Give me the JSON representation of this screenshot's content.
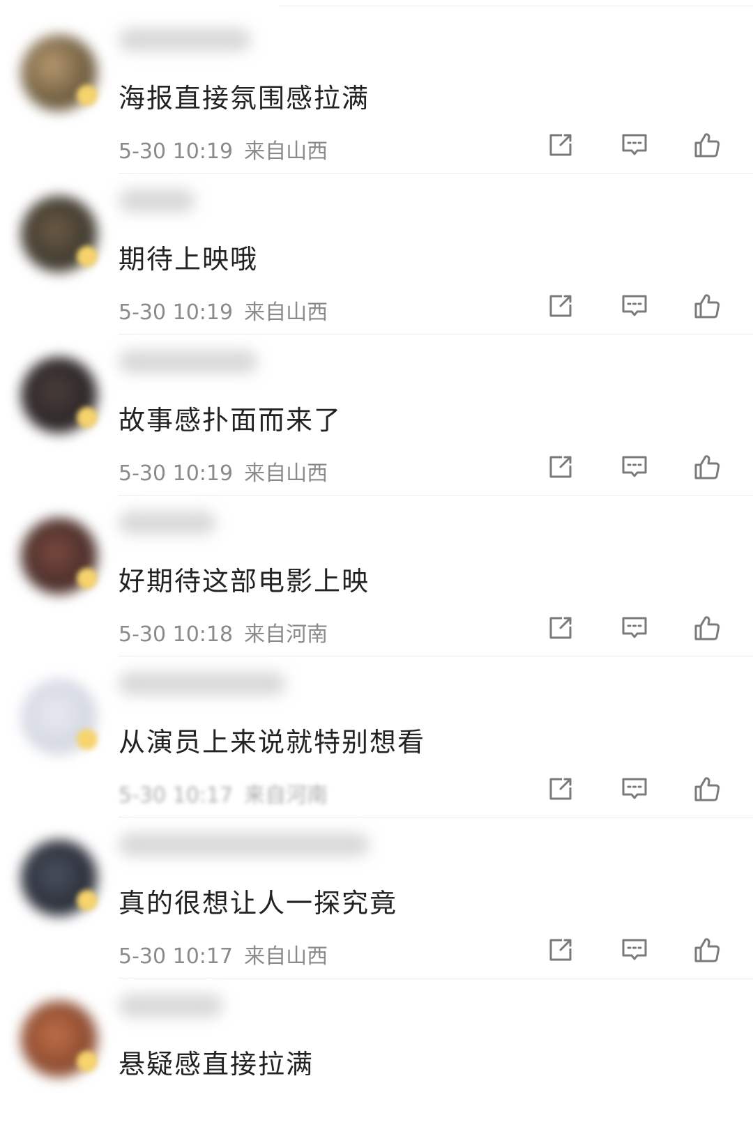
{
  "colors": {
    "text_primary": "#222222",
    "text_secondary": "#8a8a8a",
    "icon": "#7a7a7a",
    "divider": "#ececec",
    "background": "#ffffff"
  },
  "icons": {
    "share": "share-icon",
    "reply": "comment-icon",
    "like": "thumbs-up-icon"
  },
  "comments": [
    {
      "text": "海报直接氛围感拉满",
      "time": "5-30 10:19",
      "location": "来自山西"
    },
    {
      "text": "期待上映哦",
      "time": "5-30 10:19",
      "location": "来自山西"
    },
    {
      "text": "故事感扑面而来了",
      "time": "5-30 10:19",
      "location": "来自山西"
    },
    {
      "text": "好期待这部电影上映",
      "time": "5-30 10:18",
      "location": "来自河南"
    },
    {
      "text": "从演员上来说就特别想看",
      "time": "5-30 10:17",
      "location": "来自河南"
    },
    {
      "text": "真的很想让人一探究竟",
      "time": "5-30 10:17",
      "location": "来自山西"
    },
    {
      "text": "悬疑感直接拉满",
      "time": "",
      "location": ""
    }
  ]
}
